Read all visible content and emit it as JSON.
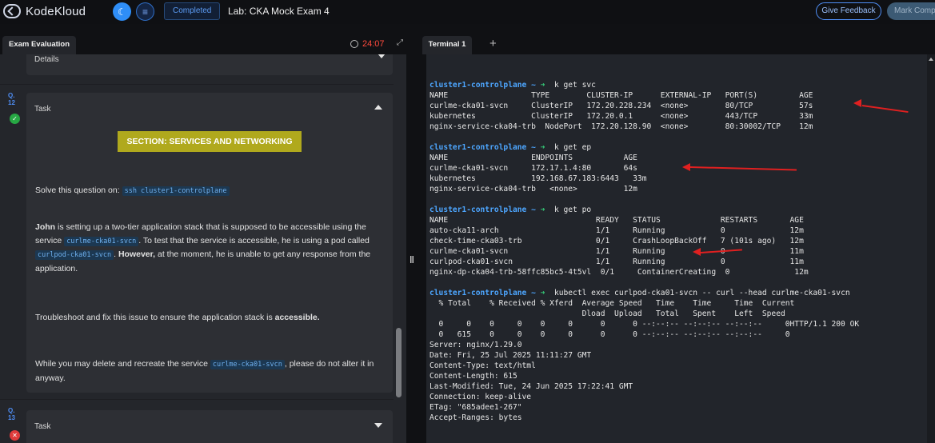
{
  "topbar": {
    "logo_text": "KodeKloud",
    "status_label": "Completed",
    "lab_title": "Lab: CKA Mock Exam 4",
    "feedback_label": "Give Feedback",
    "mark_label": "Mark Comp"
  },
  "left": {
    "tab_label": "Exam Evaluation",
    "timer": "24:07",
    "details_label": "Details",
    "q12": {
      "num_a": "Q.",
      "num_b": "12",
      "status": "pass",
      "task_label": "Task"
    },
    "q13": {
      "num_a": "Q.",
      "num_b": "13",
      "status": "fail",
      "task_label": "Task"
    },
    "section_banner": "SECTION: SERVICES AND NETWORKING",
    "solve_text": "Solve this question on: ",
    "solve_code": "ssh cluster1-controlplane",
    "p1_a": "John",
    "p1_b": " is setting up a two-tier application stack that is supposed to be accessible using the service ",
    "p1_code1": "curlme-cka01-svcn",
    "p1_c": ". To test that the service is accessible, he is using a pod called ",
    "p1_code2": "curlpod-cka01-svcn",
    "p1_d": ". ",
    "p1_e": "However,",
    "p1_f": " at the moment, he is unable to get any response from the application.",
    "p2_a": "Troubleshoot and fix this issue to ensure the application stack is ",
    "p2_b": "accessible.",
    "p3_a": "While you may delete and recreate the service ",
    "p3_code": "curlme-cka01-svcn",
    "p3_b": ", please do not alter it in anyway."
  },
  "terminal": {
    "tab_label": "Terminal 1",
    "plus": "+",
    "prompt": "cluster1-controlplane ~ ",
    "arrow": "➜",
    "lines": [
      {
        "p": true,
        "cmd": "  k get svc"
      },
      {
        "t": "NAME                  TYPE        CLUSTER-IP      EXTERNAL-IP   PORT(S)         AGE"
      },
      {
        "t": "curlme-cka01-svcn     ClusterIP   172.20.228.234  <none>        80/TCP          57s"
      },
      {
        "t": "kubernetes            ClusterIP   172.20.0.1      <none>        443/TCP         33m"
      },
      {
        "t": "nginx-service-cka04-trb  NodePort  172.20.128.90  <none>        80:30002/TCP    12m"
      },
      {
        "t": ""
      },
      {
        "p": true,
        "cmd": "  k get ep"
      },
      {
        "t": "NAME                  ENDPOINTS           AGE"
      },
      {
        "t": "curlme-cka01-svcn     172.17.1.4:80       64s"
      },
      {
        "t": "kubernetes            192.168.67.183:6443   33m"
      },
      {
        "t": "nginx-service-cka04-trb   <none>          12m"
      },
      {
        "t": ""
      },
      {
        "p": true,
        "cmd": "  k get po"
      },
      {
        "t": "NAME                                READY   STATUS             RESTARTS       AGE"
      },
      {
        "t": "auto-cka11-arch                     1/1     Running            0              12m"
      },
      {
        "t": "check-time-cka03-trb                0/1     CrashLoopBackOff   7 (101s ago)   12m"
      },
      {
        "t": "curlme-cka01-svcn                   1/1     Running            0              11m"
      },
      {
        "t": "curlpod-cka01-svcn                  1/1     Running            0              11m"
      },
      {
        "t": "nginx-dp-cka04-trb-58ffc85bc5-4t5vl  0/1     ContainerCreating  0              12m"
      },
      {
        "t": ""
      },
      {
        "p": true,
        "cmd": "  kubectl exec curlpod-cka01-svcn -- curl --head curlme-cka01-svcn"
      },
      {
        "t": "  % Total    % Received % Xferd  Average Speed   Time    Time     Time  Current"
      },
      {
        "t": "                                 Dload  Upload   Total   Spent    Left  Speed"
      },
      {
        "t": "  0     0    0     0    0     0      0      0 --:--:-- --:--:-- --:--:--     0HTTP/1.1 200 OK"
      },
      {
        "t": "  0   615    0     0    0     0      0      0 --:--:-- --:--:-- --:--:--     0"
      },
      {
        "t": "Server: nginx/1.29.0"
      },
      {
        "t": "Date: Fri, 25 Jul 2025 11:11:27 GMT"
      },
      {
        "t": "Content-Type: text/html"
      },
      {
        "t": "Content-Length: 615"
      },
      {
        "t": "Last-Modified: Tue, 24 Jun 2025 17:22:41 GMT"
      },
      {
        "t": "Connection: keep-alive"
      },
      {
        "t": "ETag: \"685adee1-267\""
      },
      {
        "t": "Accept-Ranges: bytes"
      }
    ]
  },
  "colors": {
    "accent": "#2f8ef7",
    "banner": "#b0a91d",
    "timer": "#ff4a3d",
    "prompt": "#4da6ff",
    "annotation": "#e02020"
  }
}
